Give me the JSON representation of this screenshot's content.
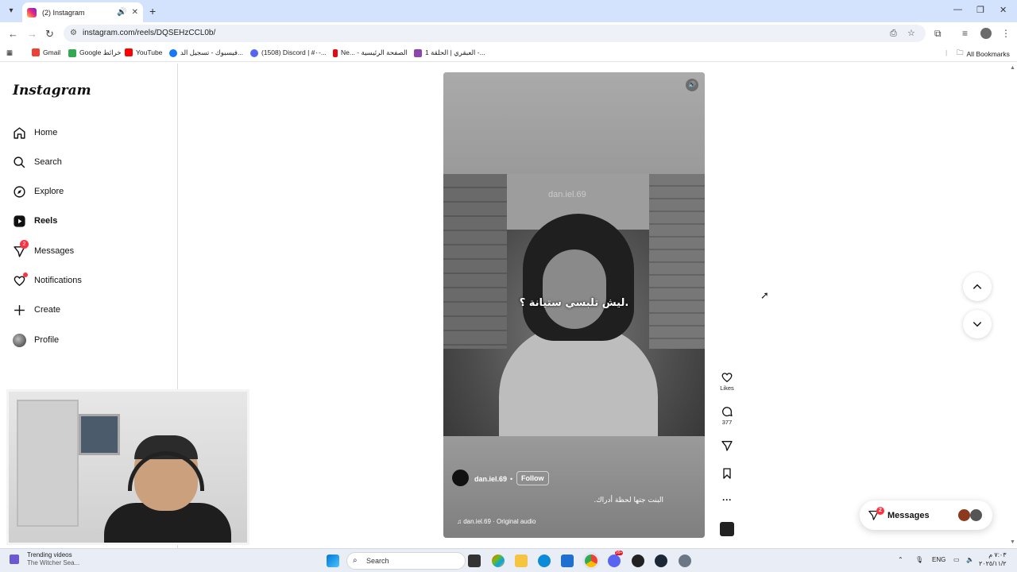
{
  "browser": {
    "tab_title": "(2) Instagram",
    "url": "instagram.com/reels/DQSEHzCCL0b/",
    "bookmarks": [
      {
        "label": "Gmail",
        "color": "#ea4335"
      },
      {
        "label": "Google خرائط",
        "color": "#34a853"
      },
      {
        "label": "YouTube",
        "color": "#ff0000"
      },
      {
        "label": "فيسبوك - تسجيل الد...",
        "color": "#1877f2"
      },
      {
        "label": "(1508) Discord | #٠-...",
        "color": "#5865f2"
      },
      {
        "label": "Ne... - الصفحة الرئيسية",
        "color": "#e50914"
      },
      {
        "label": "العبقري | الحلقة 1 -...",
        "color": "#8e44ad"
      }
    ],
    "all_bookmarks": "All Bookmarks"
  },
  "sidebar": {
    "logo": "Instagram",
    "items": [
      {
        "label": "Home",
        "icon": "home-icon"
      },
      {
        "label": "Search",
        "icon": "search-icon"
      },
      {
        "label": "Explore",
        "icon": "compass-icon"
      },
      {
        "label": "Reels",
        "icon": "reels-icon"
      },
      {
        "label": "Messages",
        "icon": "messenger-icon",
        "badge": "2"
      },
      {
        "label": "Notifications",
        "icon": "heart-icon"
      },
      {
        "label": "Create",
        "icon": "plus-icon"
      },
      {
        "label": "Profile",
        "icon": "avatar"
      }
    ]
  },
  "reel": {
    "watermark": "dan.iel.69",
    "subtitle": "ليش تلبسي ستيانة ؟.",
    "username": "dan.iel.69",
    "separator": "•",
    "follow_label": "Follow",
    "caption": "البنت جتها لحظة أدراك.",
    "audio": "dan.iel.69 · Original audio",
    "likes_label": "Likes",
    "comments_count": "377"
  },
  "messages_pill": {
    "label": "Messages",
    "badge": "2"
  },
  "taskbar": {
    "news_title": "Trending videos",
    "news_sub": "The Witcher Sea...",
    "search_label": "Search",
    "lang": "ENG",
    "time": "٧:٠٣ م",
    "date": "٢٠٢٥/١١/٢",
    "chat_badge": "99+"
  }
}
